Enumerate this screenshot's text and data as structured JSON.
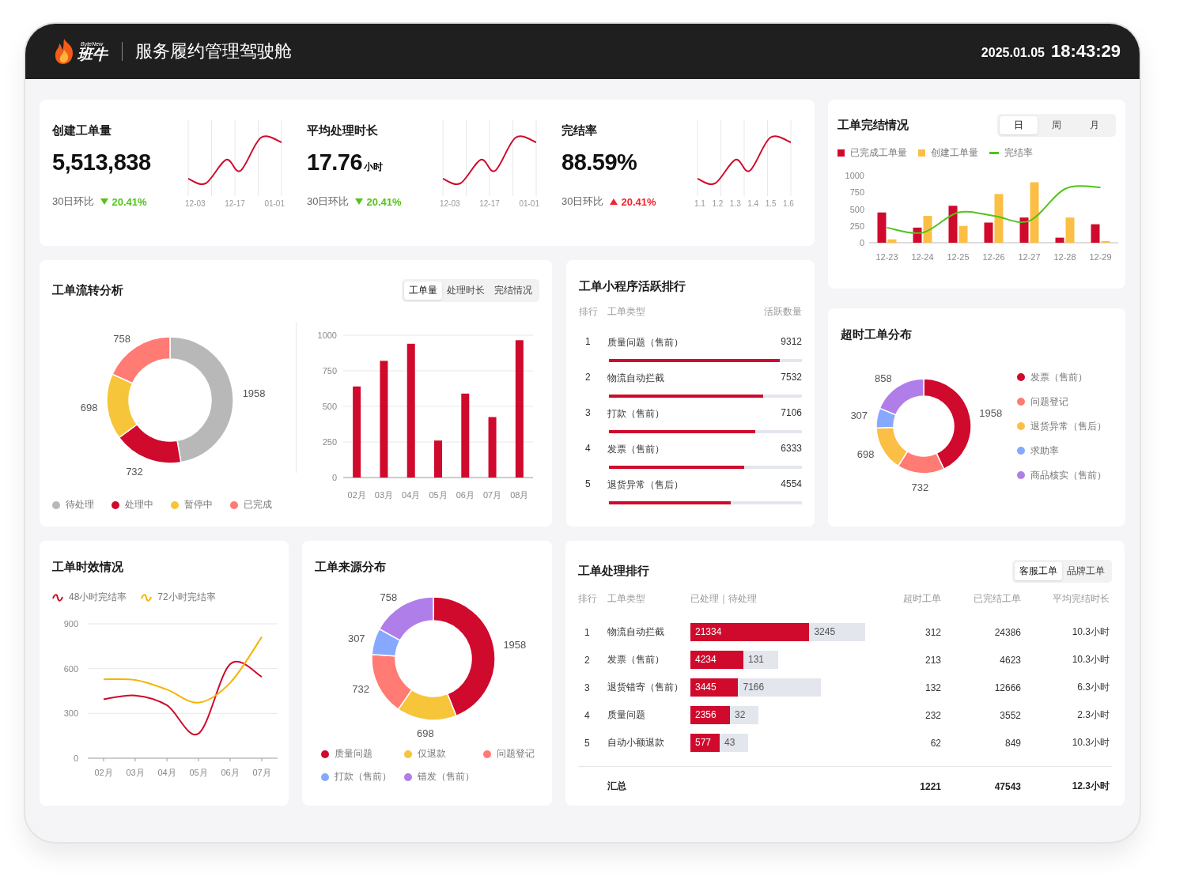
{
  "header": {
    "brand_tag": "ByteNew",
    "brand": "班牛",
    "title": "服务履约管理驾驶舱",
    "date": "2025.01.05",
    "time": "18:43:29"
  },
  "kpis": [
    {
      "title": "创建工单量",
      "value": "5,513,838",
      "compare_label": "30日环比",
      "change": "20.41%",
      "up": false,
      "axis_labels": [
        "12-03",
        "12-17",
        "01-01"
      ]
    },
    {
      "title": "平均处理时长",
      "value": "17.76",
      "unit": "小时",
      "compare_label": "30日环比",
      "change": "20.41%",
      "up": false,
      "axis_labels": [
        "12-03",
        "12-17",
        "01-01"
      ]
    },
    {
      "title": "完结率",
      "value": "88.59%",
      "compare_label": "30日环比",
      "change": "20.41%",
      "up": true,
      "axis_labels": [
        "1.1",
        "1.2",
        "1.3",
        "1.4",
        "1.5",
        "1.6"
      ]
    }
  ],
  "completion": {
    "title": "工单完结情况",
    "tabs": [
      {
        "label": "日",
        "selected": true
      },
      {
        "label": "周",
        "selected": false
      },
      {
        "label": "月",
        "selected": false
      }
    ],
    "chart_data": {
      "type": "bar",
      "categories": [
        "12-23",
        "12-24",
        "12-25",
        "12-26",
        "12-27",
        "12-28",
        "12-29"
      ],
      "yticks": [
        0,
        250,
        500,
        750,
        1000
      ],
      "ylim": [
        0,
        1000
      ],
      "series": [
        {
          "name": "已完成工单量",
          "color": "#cf0a2c",
          "type": "bar",
          "values": [
            450,
            225,
            550,
            300,
            375,
            75,
            275
          ]
        },
        {
          "name": "创建工单量",
          "color": "#fbbf45",
          "type": "bar",
          "values": [
            50,
            400,
            250,
            725,
            900,
            375,
            25
          ]
        },
        {
          "name": "完结率",
          "color": "#52c41a",
          "type": "line",
          "values": [
            225,
            150,
            450,
            400,
            325,
            800,
            825
          ]
        }
      ]
    }
  },
  "flow": {
    "title": "工单流转分析",
    "tabs": [
      {
        "label": "工单量",
        "selected": true
      },
      {
        "label": "处理时长",
        "selected": false
      },
      {
        "label": "完结情况",
        "selected": false
      }
    ],
    "donut": {
      "legend": [
        {
          "color": "#b8b8b8"
        },
        {
          "color": "#cf0a2c"
        },
        {
          "color": "#f6c53a"
        },
        {
          "color": "#ff7b74"
        }
      ],
      "chart_data": {
        "type": "donut",
        "categories": [
          "待处理",
          "处理中",
          "暂停中",
          "已完成"
        ],
        "values": [
          1958,
          732,
          698,
          758
        ],
        "data_labels": true
      }
    },
    "bars": {
      "chart_data": {
        "type": "bar",
        "grid": true,
        "categories": [
          "02月",
          "03月",
          "04月",
          "05月",
          "06月",
          "07月",
          "08月"
        ],
        "yticks": [
          0,
          250,
          500,
          750,
          1000
        ],
        "ylim": [
          0,
          1000
        ],
        "series": [
          {
            "color": "#cf0a2c",
            "values": [
              640,
              820,
              940,
              260,
              590,
              425,
              965
            ]
          }
        ]
      }
    }
  },
  "mini_ranking": {
    "title": "工单小程序活跃排行",
    "columns": [
      "排行",
      "工单类型",
      "活跃数量"
    ],
    "rows": [
      {
        "rank": "1",
        "name": "质量问题（售前）",
        "value": "9312",
        "level": 0.885
      },
      {
        "rank": "2",
        "name": "物流自动拦截",
        "value": "7532",
        "level": 0.8
      },
      {
        "rank": "3",
        "name": "打款（售前）",
        "value": "7106",
        "level": 0.76
      },
      {
        "rank": "4",
        "name": "发票（售前）",
        "value": "6333",
        "level": 0.7
      },
      {
        "rank": "5",
        "name": "退货异常（售后）",
        "value": "4554",
        "level": 0.63
      }
    ]
  },
  "overtime": {
    "title": "超时工单分布",
    "legend": [
      {
        "color": "#cf0a2c"
      },
      {
        "color": "#ff7b74"
      },
      {
        "color": "#fbbf45"
      },
      {
        "color": "#86a8ff"
      },
      {
        "color": "#b07ee8"
      }
    ],
    "chart_data": {
      "type": "donut",
      "categories": [
        "发票（售前）",
        "问题登记",
        "退货异常（售后）",
        "求助率",
        "商品核实（售前）"
      ],
      "values": [
        1958,
        732,
        698,
        307,
        858
      ],
      "data_labels": true
    }
  },
  "timeliness": {
    "title": "工单时效情况",
    "chart_data": {
      "type": "line",
      "grid": true,
      "categories": [
        "02月",
        "03月",
        "04月",
        "05月",
        "06月",
        "07月"
      ],
      "yticks": [
        0,
        300,
        600,
        900
      ],
      "ylim": [
        0,
        900
      ],
      "series": [
        {
          "name": "48小时完结率",
          "color": "#cf0a2c",
          "values": [
            395,
            420,
            355,
            165,
            630,
            545
          ]
        },
        {
          "name": "72小时完结率",
          "color": "#f5b400",
          "values": [
            528,
            524,
            460,
            372,
            505,
            812
          ]
        }
      ]
    }
  },
  "source": {
    "title": "工单来源分布",
    "legend": [
      {
        "color": "#cf0a2c"
      },
      {
        "color": "#f6c53a"
      },
      {
        "color": "#ff7b74"
      },
      {
        "color": "#86a8ff"
      },
      {
        "color": "#b07ee8"
      }
    ],
    "chart_data": {
      "type": "donut",
      "categories": [
        "质量问题",
        "仅退款",
        "问题登记",
        "打款（售前）",
        "错发（售前）"
      ],
      "values": [
        1958,
        698,
        732,
        307,
        758
      ],
      "data_labels": true
    }
  },
  "processing": {
    "title": "工单处理排行",
    "tabs": [
      {
        "label": "客服工单",
        "selected": true
      },
      {
        "label": "品牌工单",
        "selected": false
      }
    ],
    "columns": [
      "排行",
      "工单类型",
      "已处理｜待处理",
      "超时工单",
      "已完结工单",
      "平均完结时长"
    ],
    "rows": [
      {
        "rank": "1",
        "name": "物流自动拦截",
        "processed": "21334",
        "pending": "3245",
        "overtime": "312",
        "completed": "24386",
        "avg": "10.3小时"
      },
      {
        "rank": "2",
        "name": "发票（售前）",
        "processed": "4234",
        "pending": "131",
        "overtime": "213",
        "completed": "4623",
        "avg": "10.3小时"
      },
      {
        "rank": "3",
        "name": "退货错寄（售前）",
        "processed": "3445",
        "pending": "7166",
        "overtime": "132",
        "completed": "12666",
        "avg": "6.3小时"
      },
      {
        "rank": "4",
        "name": "质量问题",
        "processed": "2356",
        "pending": "32",
        "overtime": "232",
        "completed": "3552",
        "avg": "2.3小时"
      },
      {
        "rank": "5",
        "name": "自动小额退款",
        "processed": "577",
        "pending": "43",
        "overtime": "62",
        "completed": "849",
        "avg": "10.3小时"
      }
    ],
    "total": {
      "label": "汇总",
      "overtime": "1221",
      "completed": "47543",
      "avg": "12.3小时"
    }
  }
}
